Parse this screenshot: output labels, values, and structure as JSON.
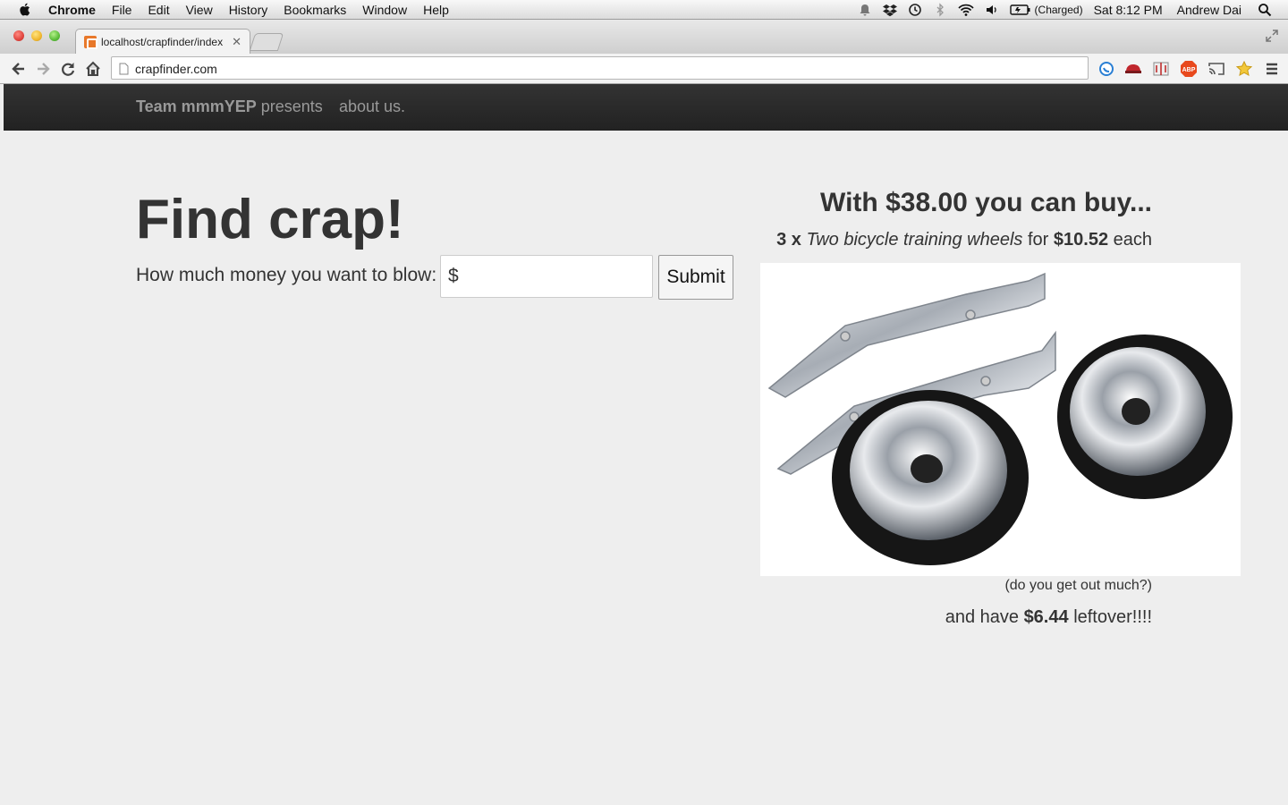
{
  "menubar": {
    "app": "Chrome",
    "items": [
      "File",
      "Edit",
      "View",
      "History",
      "Bookmarks",
      "Window",
      "Help"
    ],
    "battery_status": "(Charged)",
    "clock": "Sat 8:12 PM",
    "user": "Andrew Dai"
  },
  "browser": {
    "tab_title": "localhost/crapfinder/index",
    "url": "crapfinder.com"
  },
  "navbar": {
    "team": "Team mmmYEP",
    "presents": " presents",
    "about": "about us."
  },
  "form": {
    "heading": "Find crap!",
    "prompt": "How much money you want to blow:",
    "input_value": "$",
    "submit_label": "Submit"
  },
  "result": {
    "heading": "With $38.00 you can buy...",
    "quantity": "3 x",
    "item_name": "Two bicycle training wheels",
    "for_word": "for",
    "price": "$10.52",
    "each_word": "each",
    "caption": "(do you get out much?)",
    "leftover_prefix": "and have",
    "leftover_amount": "$6.44",
    "leftover_suffix": "leftover!!!!"
  },
  "colors": {
    "page_background": "#eeeeee",
    "navbar_background": "#222222",
    "text": "#333333"
  }
}
